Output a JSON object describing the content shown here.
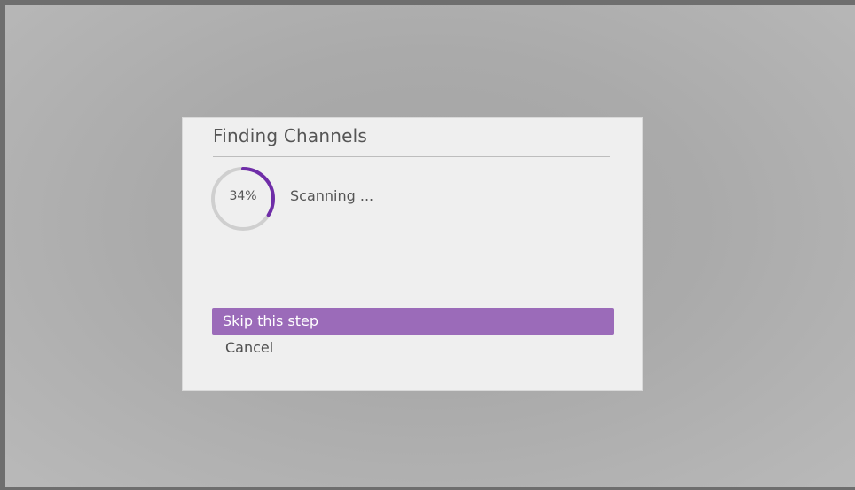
{
  "dialog": {
    "title": "Finding Channels",
    "progress": {
      "percent": 34,
      "label": "34%",
      "ring_color": "#6f2da8",
      "track_color": "#cfcfcf"
    },
    "status": "Scanning ...",
    "options": [
      {
        "label": "Skip this step",
        "selected": true
      },
      {
        "label": "Cancel",
        "selected": false
      }
    ],
    "accent_color": "#9b6bb9"
  }
}
